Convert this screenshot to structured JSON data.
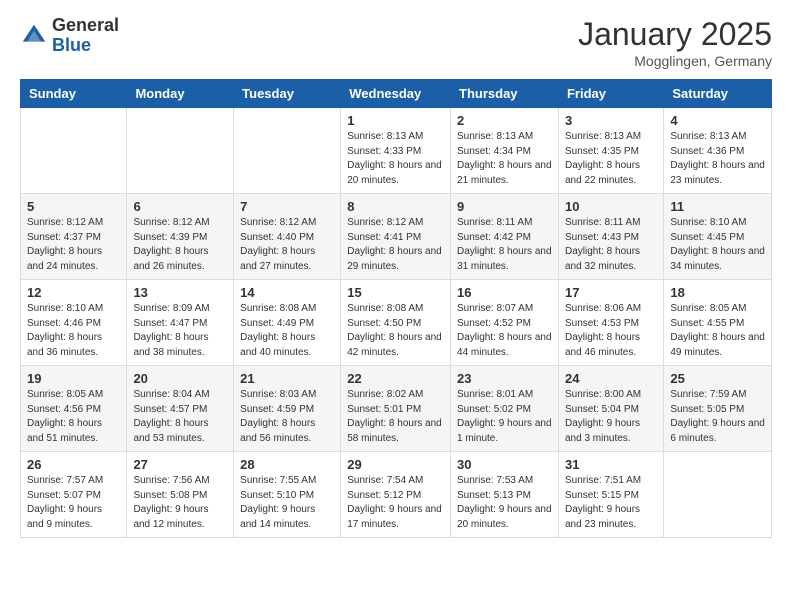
{
  "header": {
    "logo_general": "General",
    "logo_blue": "Blue",
    "month_title": "January 2025",
    "location": "Mogglingen, Germany"
  },
  "columns": [
    "Sunday",
    "Monday",
    "Tuesday",
    "Wednesday",
    "Thursday",
    "Friday",
    "Saturday"
  ],
  "weeks": [
    {
      "days": [
        {
          "num": "",
          "info": ""
        },
        {
          "num": "",
          "info": ""
        },
        {
          "num": "",
          "info": ""
        },
        {
          "num": "1",
          "info": "Sunrise: 8:13 AM\nSunset: 4:33 PM\nDaylight: 8 hours\nand 20 minutes."
        },
        {
          "num": "2",
          "info": "Sunrise: 8:13 AM\nSunset: 4:34 PM\nDaylight: 8 hours\nand 21 minutes."
        },
        {
          "num": "3",
          "info": "Sunrise: 8:13 AM\nSunset: 4:35 PM\nDaylight: 8 hours\nand 22 minutes."
        },
        {
          "num": "4",
          "info": "Sunrise: 8:13 AM\nSunset: 4:36 PM\nDaylight: 8 hours\nand 23 minutes."
        }
      ]
    },
    {
      "days": [
        {
          "num": "5",
          "info": "Sunrise: 8:12 AM\nSunset: 4:37 PM\nDaylight: 8 hours\nand 24 minutes."
        },
        {
          "num": "6",
          "info": "Sunrise: 8:12 AM\nSunset: 4:39 PM\nDaylight: 8 hours\nand 26 minutes."
        },
        {
          "num": "7",
          "info": "Sunrise: 8:12 AM\nSunset: 4:40 PM\nDaylight: 8 hours\nand 27 minutes."
        },
        {
          "num": "8",
          "info": "Sunrise: 8:12 AM\nSunset: 4:41 PM\nDaylight: 8 hours\nand 29 minutes."
        },
        {
          "num": "9",
          "info": "Sunrise: 8:11 AM\nSunset: 4:42 PM\nDaylight: 8 hours\nand 31 minutes."
        },
        {
          "num": "10",
          "info": "Sunrise: 8:11 AM\nSunset: 4:43 PM\nDaylight: 8 hours\nand 32 minutes."
        },
        {
          "num": "11",
          "info": "Sunrise: 8:10 AM\nSunset: 4:45 PM\nDaylight: 8 hours\nand 34 minutes."
        }
      ]
    },
    {
      "days": [
        {
          "num": "12",
          "info": "Sunrise: 8:10 AM\nSunset: 4:46 PM\nDaylight: 8 hours\nand 36 minutes."
        },
        {
          "num": "13",
          "info": "Sunrise: 8:09 AM\nSunset: 4:47 PM\nDaylight: 8 hours\nand 38 minutes."
        },
        {
          "num": "14",
          "info": "Sunrise: 8:08 AM\nSunset: 4:49 PM\nDaylight: 8 hours\nand 40 minutes."
        },
        {
          "num": "15",
          "info": "Sunrise: 8:08 AM\nSunset: 4:50 PM\nDaylight: 8 hours\nand 42 minutes."
        },
        {
          "num": "16",
          "info": "Sunrise: 8:07 AM\nSunset: 4:52 PM\nDaylight: 8 hours\nand 44 minutes."
        },
        {
          "num": "17",
          "info": "Sunrise: 8:06 AM\nSunset: 4:53 PM\nDaylight: 8 hours\nand 46 minutes."
        },
        {
          "num": "18",
          "info": "Sunrise: 8:05 AM\nSunset: 4:55 PM\nDaylight: 8 hours\nand 49 minutes."
        }
      ]
    },
    {
      "days": [
        {
          "num": "19",
          "info": "Sunrise: 8:05 AM\nSunset: 4:56 PM\nDaylight: 8 hours\nand 51 minutes."
        },
        {
          "num": "20",
          "info": "Sunrise: 8:04 AM\nSunset: 4:57 PM\nDaylight: 8 hours\nand 53 minutes."
        },
        {
          "num": "21",
          "info": "Sunrise: 8:03 AM\nSunset: 4:59 PM\nDaylight: 8 hours\nand 56 minutes."
        },
        {
          "num": "22",
          "info": "Sunrise: 8:02 AM\nSunset: 5:01 PM\nDaylight: 8 hours\nand 58 minutes."
        },
        {
          "num": "23",
          "info": "Sunrise: 8:01 AM\nSunset: 5:02 PM\nDaylight: 9 hours\nand 1 minute."
        },
        {
          "num": "24",
          "info": "Sunrise: 8:00 AM\nSunset: 5:04 PM\nDaylight: 9 hours\nand 3 minutes."
        },
        {
          "num": "25",
          "info": "Sunrise: 7:59 AM\nSunset: 5:05 PM\nDaylight: 9 hours\nand 6 minutes."
        }
      ]
    },
    {
      "days": [
        {
          "num": "26",
          "info": "Sunrise: 7:57 AM\nSunset: 5:07 PM\nDaylight: 9 hours\nand 9 minutes."
        },
        {
          "num": "27",
          "info": "Sunrise: 7:56 AM\nSunset: 5:08 PM\nDaylight: 9 hours\nand 12 minutes."
        },
        {
          "num": "28",
          "info": "Sunrise: 7:55 AM\nSunset: 5:10 PM\nDaylight: 9 hours\nand 14 minutes."
        },
        {
          "num": "29",
          "info": "Sunrise: 7:54 AM\nSunset: 5:12 PM\nDaylight: 9 hours\nand 17 minutes."
        },
        {
          "num": "30",
          "info": "Sunrise: 7:53 AM\nSunset: 5:13 PM\nDaylight: 9 hours\nand 20 minutes."
        },
        {
          "num": "31",
          "info": "Sunrise: 7:51 AM\nSunset: 5:15 PM\nDaylight: 9 hours\nand 23 minutes."
        },
        {
          "num": "",
          "info": ""
        }
      ]
    }
  ]
}
